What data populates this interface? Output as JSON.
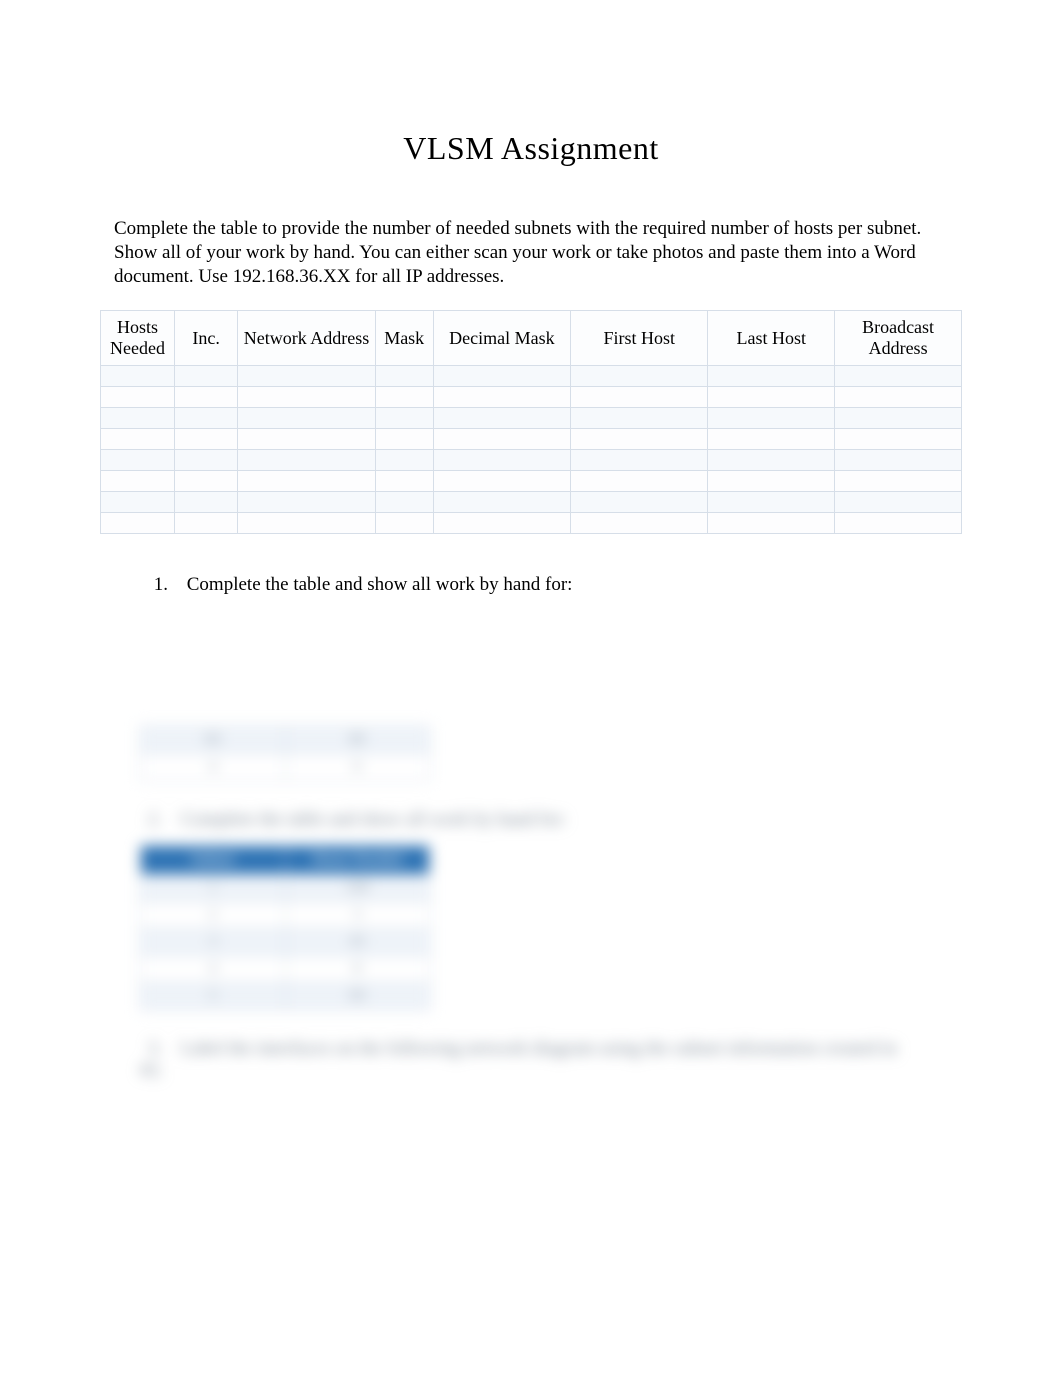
{
  "title": "VLSM Assignment",
  "instructions": "Complete the table to provide the number of needed subnets with the required number of hosts per subnet.  Show all of your work by hand. You can either scan your work or take photos and paste them into a Word document.   Use 192.168.36.XX for all IP addresses.",
  "table": {
    "headers": {
      "hosts": "Hosts Needed",
      "inc": "Inc.",
      "network_address": "Network Address",
      "mask": "Mask",
      "decimal_mask": "Decimal Mask",
      "first_host": "First Host",
      "last_host": "Last Host",
      "broadcast_address": "Broadcast Address"
    },
    "row_count": 8
  },
  "list": {
    "item1_number": "1.",
    "item1_text": "Complete the table and show all work by hand for:"
  },
  "blurred": {
    "mini1": {
      "rows": [
        {
          "a": "60",
          "b": "80"
        },
        {
          "a": "4",
          "b": "6"
        }
      ]
    },
    "item2_number": "2.",
    "item2_text": "Complete the table and show all work by hand for:",
    "mini2": {
      "header_a": "Subnet",
      "header_b": "Hosts Needed",
      "rows": [
        {
          "a": "1",
          "b": "100"
        },
        {
          "a": "2",
          "b": "3"
        },
        {
          "a": "3",
          "b": "45"
        },
        {
          "a": "4",
          "b": "8"
        },
        {
          "a": "5",
          "b": "60"
        }
      ]
    },
    "item3_number": "3.",
    "item3_text": "Label the interfaces on the following network diagram using the subnet information created in #2."
  }
}
